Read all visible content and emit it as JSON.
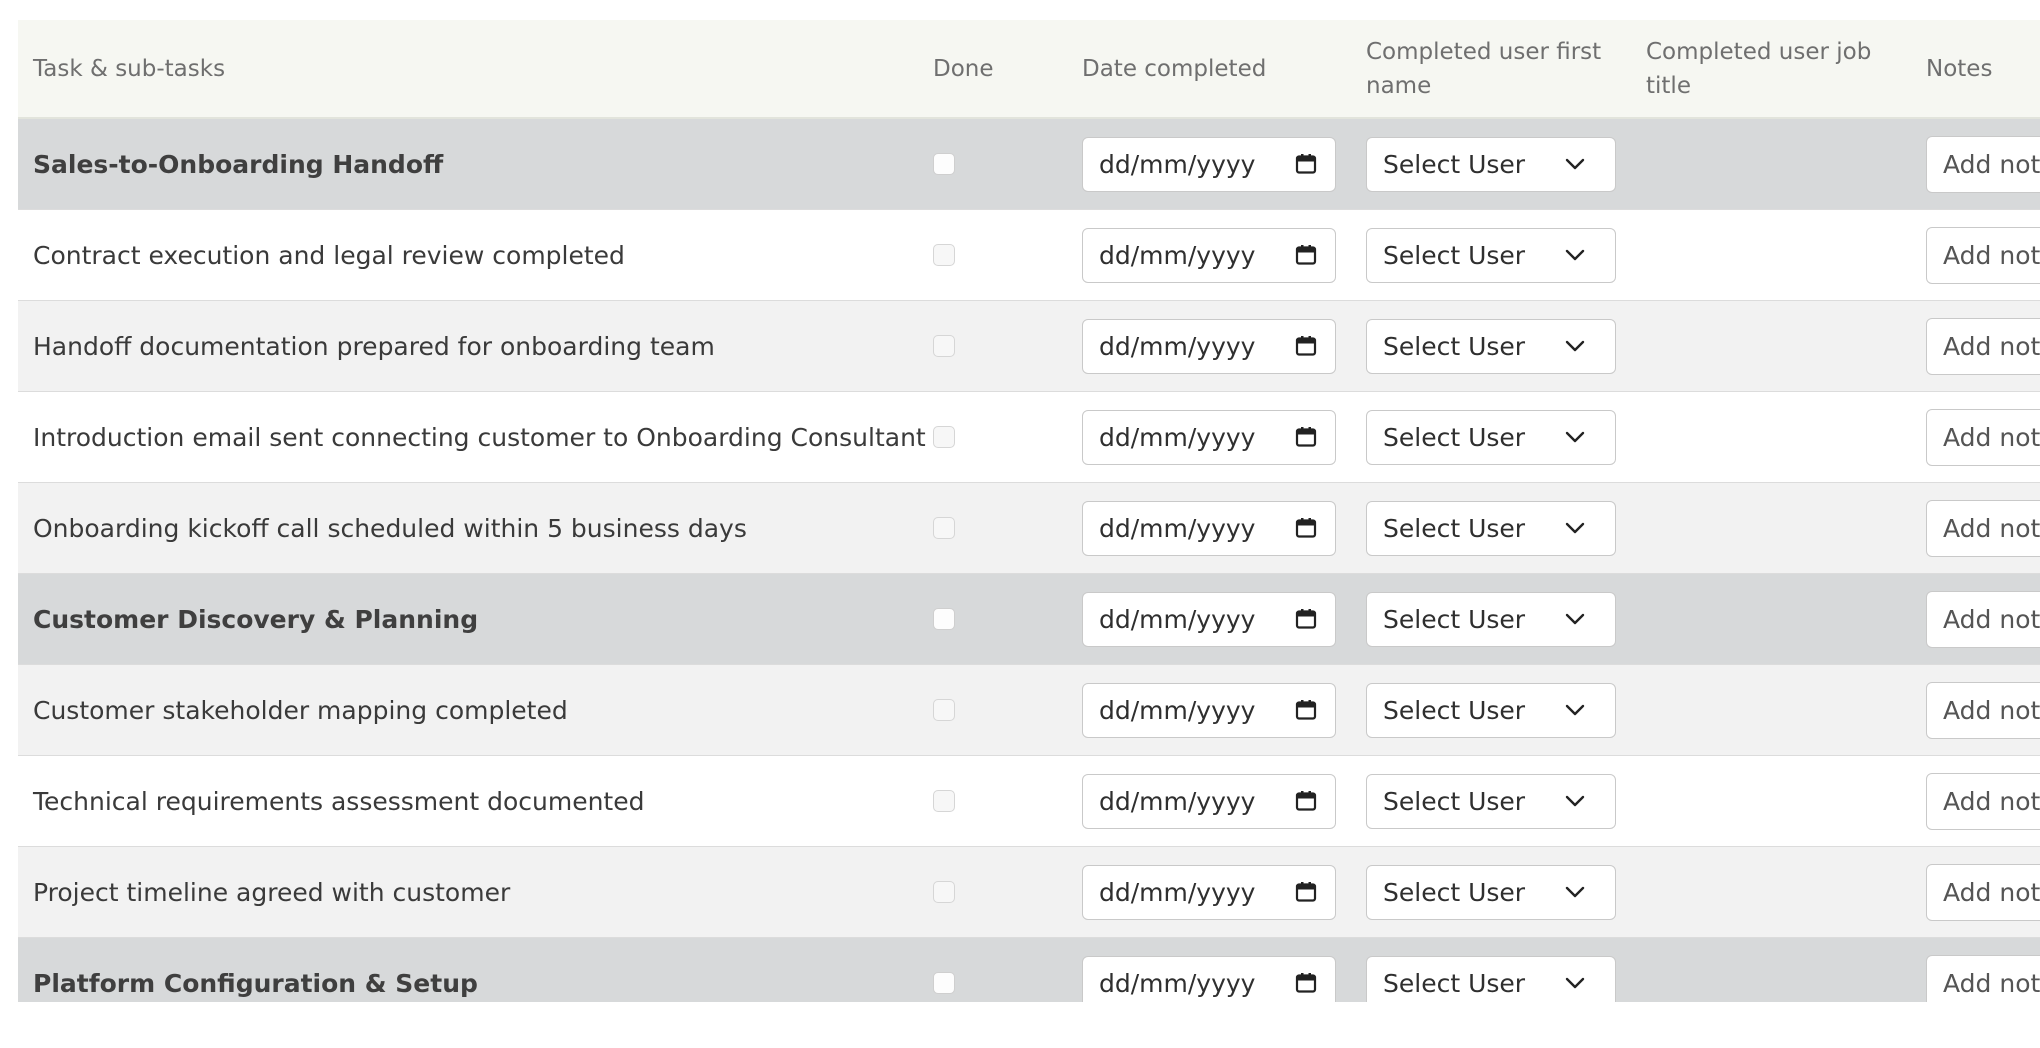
{
  "table": {
    "headers": {
      "task": "Task & sub-tasks",
      "done": "Done",
      "date": "Date completed",
      "user": "Completed user first name",
      "title": "Completed user job title",
      "notes": "Notes"
    },
    "rows": [
      {
        "task": "Sales-to-Onboarding Handoff",
        "kind": "section",
        "done": false,
        "date": "dd/mm/yyyy",
        "user": "Select User",
        "title": "",
        "notes_placeholder": "Add notes"
      },
      {
        "task": "Contract execution and legal review completed",
        "kind": "plain",
        "done": false,
        "date": "dd/mm/yyyy",
        "user": "Select User",
        "title": "",
        "notes_placeholder": "Add notes"
      },
      {
        "task": "Handoff documentation prepared for onboarding team",
        "kind": "alt",
        "done": false,
        "date": "dd/mm/yyyy",
        "user": "Select User",
        "title": "",
        "notes_placeholder": "Add notes"
      },
      {
        "task": "Introduction email sent connecting customer to Onboarding Consultant",
        "kind": "plain",
        "done": false,
        "date": "dd/mm/yyyy",
        "user": "Select User",
        "title": "",
        "notes_placeholder": "Add notes"
      },
      {
        "task": "Onboarding kickoff call scheduled within 5 business days",
        "kind": "alt",
        "done": false,
        "date": "dd/mm/yyyy",
        "user": "Select User",
        "title": "",
        "notes_placeholder": "Add notes"
      },
      {
        "task": "Customer Discovery & Planning",
        "kind": "section",
        "done": false,
        "date": "dd/mm/yyyy",
        "user": "Select User",
        "title": "",
        "notes_placeholder": "Add notes"
      },
      {
        "task": "Customer stakeholder mapping completed",
        "kind": "alt",
        "done": false,
        "date": "dd/mm/yyyy",
        "user": "Select User",
        "title": "",
        "notes_placeholder": "Add notes"
      },
      {
        "task": "Technical requirements assessment documented",
        "kind": "plain",
        "done": false,
        "date": "dd/mm/yyyy",
        "user": "Select User",
        "title": "",
        "notes_placeholder": "Add notes"
      },
      {
        "task": "Project timeline agreed with customer",
        "kind": "alt",
        "done": false,
        "date": "dd/mm/yyyy",
        "user": "Select User",
        "title": "",
        "notes_placeholder": "Add notes"
      },
      {
        "task": "Platform Configuration & Setup",
        "kind": "section",
        "done": false,
        "date": "dd/mm/yyyy",
        "user": "Select User",
        "title": "",
        "notes_placeholder": "Add notes"
      }
    ]
  },
  "icons": {
    "calendar": "calendar-icon",
    "dropdown": "chevron-down-icon"
  },
  "colors": {
    "header_bg": "#f6f7f2",
    "section_bg": "#d7d9da",
    "alt_bg": "#f2f2f2",
    "border": "#c9c9c9"
  }
}
